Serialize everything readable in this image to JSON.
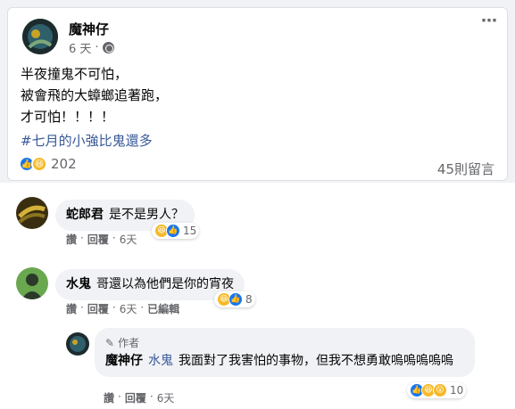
{
  "post": {
    "author": "魔神仔",
    "time": "6 天",
    "more_icon": "⋯",
    "lines": [
      "半夜撞鬼不可怕，",
      "被會飛的大蟑螂追著跑，",
      "才可怕！！！！"
    ],
    "hashtag": "#七月的小強比鬼還多",
    "reaction_count": "202",
    "comment_count": "45則留言"
  },
  "comments": [
    {
      "name": "蛇郎君",
      "text": "是不是男人？",
      "like": "讚",
      "reply": "回覆",
      "time": "6天",
      "reactions": "15"
    },
    {
      "name": "水鬼",
      "text": "哥還以為他們是你的宵夜",
      "like": "讚",
      "reply": "回覆",
      "time": "6天",
      "edited": "已編輯",
      "reactions": "8"
    },
    {
      "badge": "作者",
      "name": "魔神仔",
      "mention": "水鬼",
      "text": "我面對了我害怕的事物，但我不想勇敢嗚嗚嗚嗚嗚",
      "like": "讚",
      "reply": "回覆",
      "time": "6天",
      "reactions": "10"
    }
  ],
  "colors": {
    "like": "#1877f2",
    "haha": "#f7b928",
    "link": "#385898"
  }
}
